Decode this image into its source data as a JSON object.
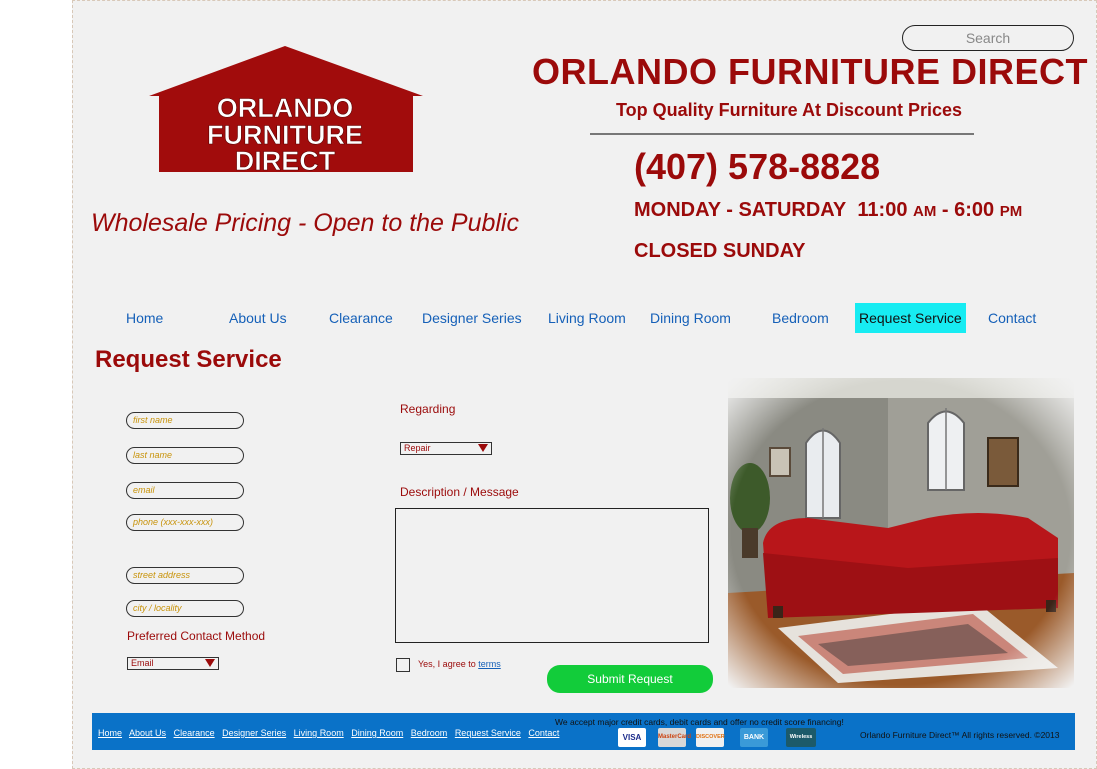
{
  "header": {
    "logo_text": [
      "ORLANDO",
      "FURNITURE",
      "DIRECT"
    ],
    "brand": "ORLANDO FURNITURE DIRECT",
    "subtitle": "Top Quality Furniture At Discount Prices",
    "phone": "(407) 578-8828",
    "hours_days": "MONDAY - SATURDAY",
    "hours_open": "11:00",
    "hours_am": "AM",
    "hours_dash": "-",
    "hours_close": "6:00",
    "hours_pm": "PM",
    "closed": "CLOSED SUNDAY",
    "tagline": "Wholesale Pricing - Open to the Public",
    "search_placeholder": "Search"
  },
  "nav": {
    "items": [
      "Home",
      "About Us",
      "Clearance",
      "Designer Series",
      "Living Room",
      "Dining Room",
      "Bedroom",
      "Request Service",
      "Contact"
    ],
    "active": "Request Service"
  },
  "page_title": "Request Service",
  "form": {
    "first_name": "first name",
    "last_name": "last name",
    "email": "email",
    "phone": "phone (xxx-xxx-xxx)",
    "street": "street address",
    "city": "city / locality",
    "preferred_label": "Preferred Contact Method",
    "preferred_value": "Email",
    "regarding_label": "Regarding",
    "regarding_value": "Repair",
    "description_label": "Description / Message",
    "agree_text": "Yes, I agree to",
    "terms_link": "terms",
    "submit_label": "Submit Request"
  },
  "footer": {
    "links": [
      "Home",
      "About Us",
      "Clearance",
      "Designer Series",
      "Living Room",
      "Dining Room",
      "Bedroom",
      "Request Service",
      "Contact"
    ],
    "accept": "We accept major credit cards, debit cards and offer no credit score financing!",
    "cards": [
      "VISA",
      "MasterCard",
      "DISCOVER",
      "BANK",
      "Wireless"
    ],
    "copyright": "Orlando Furniture Direct™ All rights reserved. ©2013"
  },
  "colors": {
    "brand_red": "#9b0a0a",
    "nav_blue": "#1560b8",
    "active_nav": "#17ecf2",
    "submit_green": "#12cc3a",
    "footer_blue": "#0a72c8"
  }
}
